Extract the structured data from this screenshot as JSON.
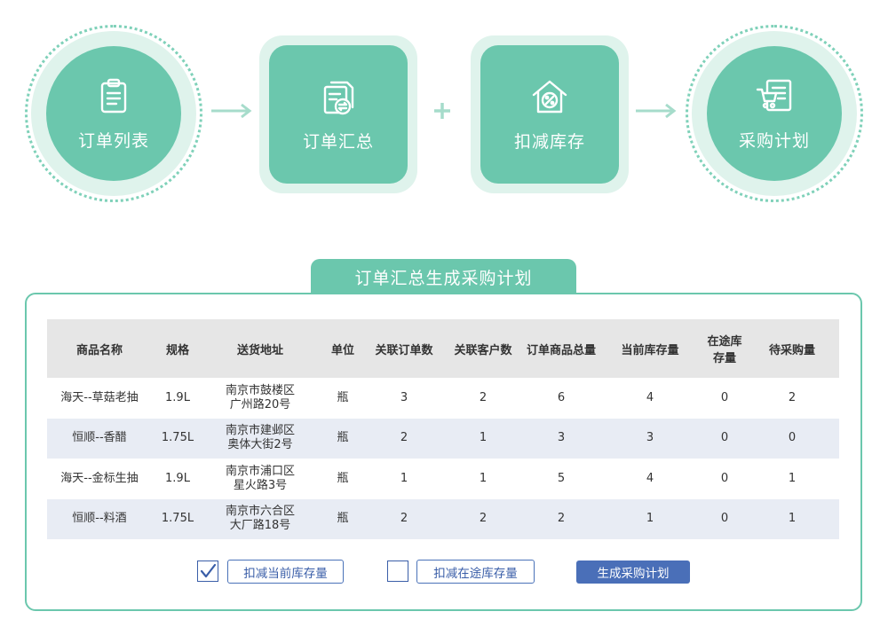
{
  "flow": {
    "steps": [
      {
        "label": "订单列表",
        "icon": "clipboard-list-icon"
      },
      {
        "label": "订单汇总",
        "icon": "document-exchange-icon"
      },
      {
        "label": "扣减库存",
        "icon": "house-percent-icon"
      },
      {
        "label": "采购计划",
        "icon": "cart-list-icon"
      }
    ],
    "connectors": [
      "arrow",
      "plus",
      "arrow"
    ]
  },
  "panel": {
    "title": "订单汇总生成采购计划",
    "columns": [
      "商品名称",
      "规格",
      "送货地址",
      "单位",
      "关联订单数",
      "关联客户数",
      "订单商品总量",
      "当前库存量",
      "在途库存量",
      "待采购量"
    ],
    "rows": [
      {
        "name": "海天--草菇老抽",
        "spec": "1.9L",
        "addr1": "南京市鼓楼区",
        "addr2": "广州路20号",
        "unit": "瓶",
        "orders": "3",
        "customers": "2",
        "total": "6",
        "stock": "4",
        "transit": "0",
        "purchase": "2"
      },
      {
        "name": "恒顺--香醋",
        "spec": "1.75L",
        "addr1": "南京市建邺区",
        "addr2": "奥体大街2号",
        "unit": "瓶",
        "orders": "2",
        "customers": "1",
        "total": "3",
        "stock": "3",
        "transit": "0",
        "purchase": "0"
      },
      {
        "name": "海天--金标生抽",
        "spec": "1.9L",
        "addr1": "南京市浦口区",
        "addr2": "星火路3号",
        "unit": "瓶",
        "orders": "1",
        "customers": "1",
        "total": "5",
        "stock": "4",
        "transit": "0",
        "purchase": "1"
      },
      {
        "name": "恒顺--料酒",
        "spec": "1.75L",
        "addr1": "南京市六合区",
        "addr2": "大厂路18号",
        "unit": "瓶",
        "orders": "2",
        "customers": "2",
        "total": "2",
        "stock": "1",
        "transit": "0",
        "purchase": "1"
      }
    ],
    "options": [
      {
        "label": "扣减当前库存量",
        "checked": true
      },
      {
        "label": "扣减在途库存量",
        "checked": false
      }
    ],
    "generate_label": "生成采购计划"
  },
  "colors": {
    "teal": "#6bc7ad",
    "teal_light": "#dff3ec",
    "blue": "#4a6fb8",
    "link": "#3a6fb0"
  }
}
